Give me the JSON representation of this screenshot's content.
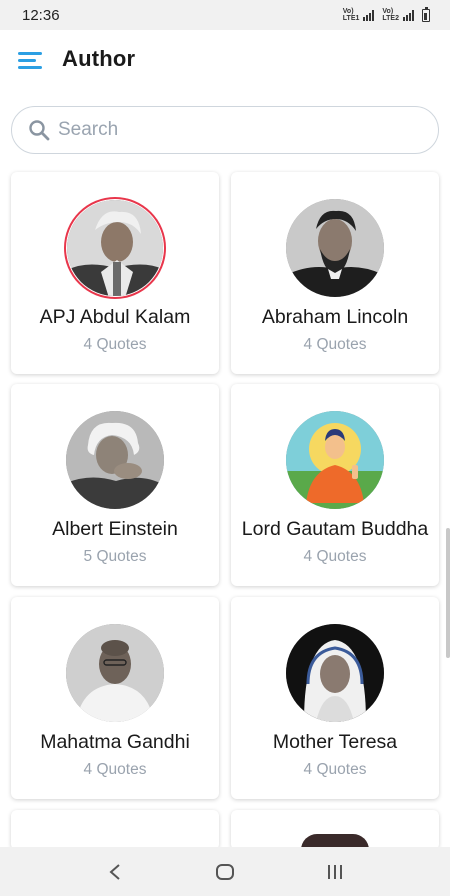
{
  "status_bar": {
    "time": "12:36",
    "sim1": "VoB LTE1",
    "sim2": "VoB LTE2"
  },
  "header": {
    "title": "Author",
    "menu_icon": "menu-icon"
  },
  "search": {
    "placeholder": "Search",
    "value": "",
    "icon": "search-icon"
  },
  "authors": [
    {
      "name": "APJ Abdul Kalam",
      "quotes": "4 Quotes",
      "selected": true
    },
    {
      "name": "Abraham Lincoln",
      "quotes": "4 Quotes"
    },
    {
      "name": "Albert Einstein",
      "quotes": "5 Quotes"
    },
    {
      "name": "Lord Gautam Buddha",
      "quotes": "4 Quotes"
    },
    {
      "name": "Mahatma Gandhi",
      "quotes": "4 Quotes"
    },
    {
      "name": "Mother Teresa",
      "quotes": "4 Quotes"
    }
  ],
  "nav": {
    "back": "back-icon",
    "home": "home-icon",
    "recents": "recents-icon"
  },
  "colors": {
    "accent": "#2c9fe3",
    "selected_ring": "#e8364b",
    "muted_text": "#9aa3ae"
  }
}
